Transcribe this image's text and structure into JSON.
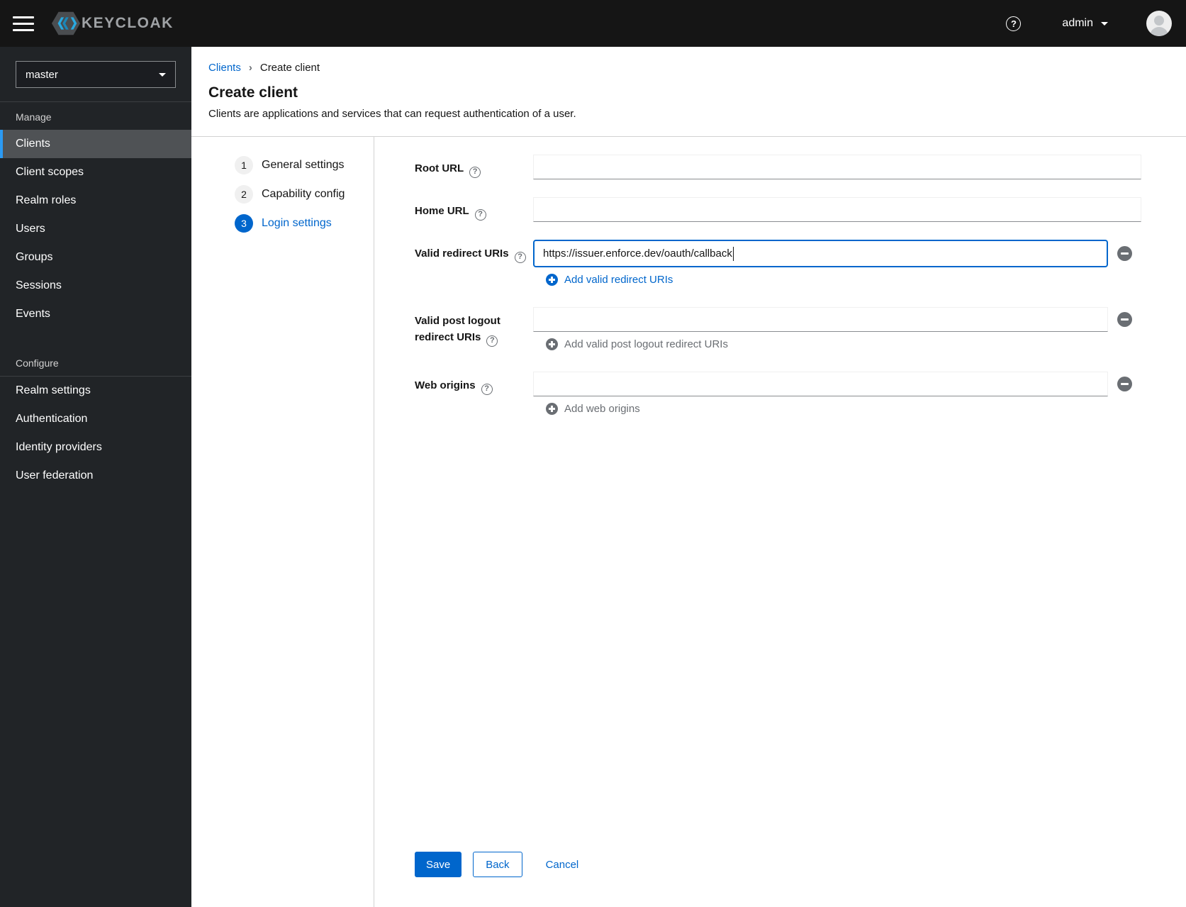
{
  "masthead": {
    "brand_text": "KEYCLOAK",
    "help_glyph": "?",
    "username": "admin"
  },
  "sidebar": {
    "realm": "master",
    "sections": [
      {
        "title": "Manage",
        "items": [
          "Clients",
          "Client scopes",
          "Realm roles",
          "Users",
          "Groups",
          "Sessions",
          "Events"
        ],
        "active_item": "Clients"
      },
      {
        "title": "Configure",
        "items": [
          "Realm settings",
          "Authentication",
          "Identity providers",
          "User federation"
        ]
      }
    ]
  },
  "breadcrumb": {
    "parent": "Clients",
    "separator": "›",
    "current": "Create client"
  },
  "page": {
    "title": "Create client",
    "subtitle": "Clients are applications and services that can request authentication of a user."
  },
  "wizard": {
    "active_step": "3",
    "steps": [
      {
        "num": "1",
        "label": "General settings"
      },
      {
        "num": "2",
        "label": "Capability config"
      },
      {
        "num": "3",
        "label": "Login settings"
      }
    ]
  },
  "form": {
    "help_glyph": "?",
    "root_url": {
      "label": "Root URL",
      "value": ""
    },
    "home_url": {
      "label": "Home URL",
      "value": ""
    },
    "redirect_uris": {
      "label": "Valid redirect URIs",
      "value": "https://issuer.enforce.dev/oauth/callback",
      "add_label": "Add valid redirect URIs",
      "add_enabled": true
    },
    "post_logout_uris": {
      "label": "Valid post logout redirect URIs",
      "value": "",
      "add_label": "Add valid post logout redirect URIs",
      "add_enabled": false
    },
    "web_origins": {
      "label": "Web origins",
      "value": "",
      "add_label": "Add web origins",
      "add_enabled": false
    }
  },
  "actions": {
    "save": "Save",
    "back": "Back",
    "cancel": "Cancel"
  },
  "colors": {
    "accent": "#0066cc",
    "masthead_bg": "#151515",
    "sidebar_bg": "#212427",
    "active_nav_bg": "#4f5255",
    "nav_indicator": "#2b9af3",
    "disabled_text": "#6a6e73",
    "logo_blue": "#29aae1"
  }
}
